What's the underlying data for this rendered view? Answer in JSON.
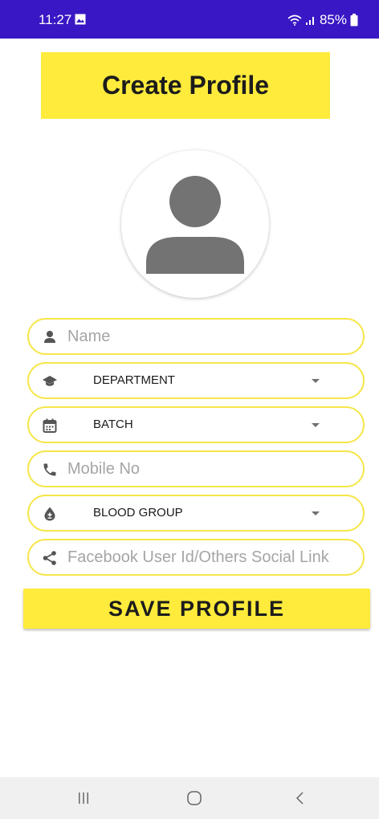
{
  "status_bar": {
    "time": "11:27",
    "battery": "85%",
    "icons": [
      "image-icon",
      "wifi-icon",
      "signal-icon",
      "battery-icon"
    ]
  },
  "header": {
    "title": "Create Profile"
  },
  "avatar": {
    "icon": "person-icon"
  },
  "form": {
    "name": {
      "placeholder": "Name",
      "icon": "person-icon"
    },
    "department": {
      "label": "DEPARTMENT",
      "icon": "graduation-cap-icon"
    },
    "batch": {
      "label": "BATCH",
      "icon": "calendar-icon"
    },
    "mobile": {
      "placeholder": "Mobile No",
      "icon": "phone-icon"
    },
    "blood_group": {
      "label": "BLOOD GROUP",
      "icon": "blood-drop-icon"
    },
    "social": {
      "placeholder": "Facebook User Id/Others Social Link",
      "icon": "share-icon"
    }
  },
  "save_button": {
    "label": "SAVE PROFILE"
  },
  "colors": {
    "status_bar": "#3a17c4",
    "accent_yellow": "#ffeb3b",
    "field_border": "#f5e64a"
  }
}
